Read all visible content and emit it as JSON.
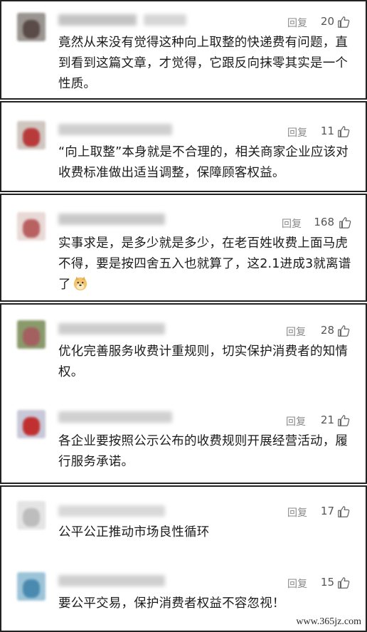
{
  "reply_label": "回复",
  "comments": [
    {
      "likes": "20",
      "text": "竟然从来没有觉得这种向上取整的快递费有问题，直到看到这篇文章，才觉得，它跟反向抹零其实是一个性质。",
      "avatar_colors": [
        "#9a9590",
        "#5a4a48"
      ]
    },
    {
      "likes": "11",
      "text": "“向上取整”本身就是不合理的，相关商家企业应该对收费标准做出适当调整，保障顾客权益。",
      "avatar_colors": [
        "#cfc6c0",
        "#b83a3a"
      ]
    },
    {
      "likes": "168",
      "text": "实事求是，是多少就是多少，在老百姓收费上面马虎不得，要是按四舍五入也就算了，这2.1进成3就离谱了",
      "avatar_colors": [
        "#e8d9d6",
        "#b96060"
      ]
    },
    {
      "likes": "28",
      "text": "优化完善服务收费计重规则，切实保护消费者的知情权。",
      "avatar_colors": [
        "#8a9a6a",
        "#a46060"
      ]
    },
    {
      "likes": "21",
      "text": "各企业要按照公示公布的收费规则开展经营活动，履行服务承诺。",
      "avatar_colors": [
        "#c8c8d8",
        "#c03030"
      ]
    },
    {
      "likes": "17",
      "text": "公平公正推动市场良性循环",
      "avatar_colors": [
        "#e4e4e4",
        "#bdbdbd"
      ]
    },
    {
      "likes": "15",
      "text": "要公平交易，保护消费者权益不容忽视！",
      "avatar_colors": [
        "#9cc4d8",
        "#4a8ab0"
      ]
    }
  ],
  "watermark": "www.365jz.com"
}
